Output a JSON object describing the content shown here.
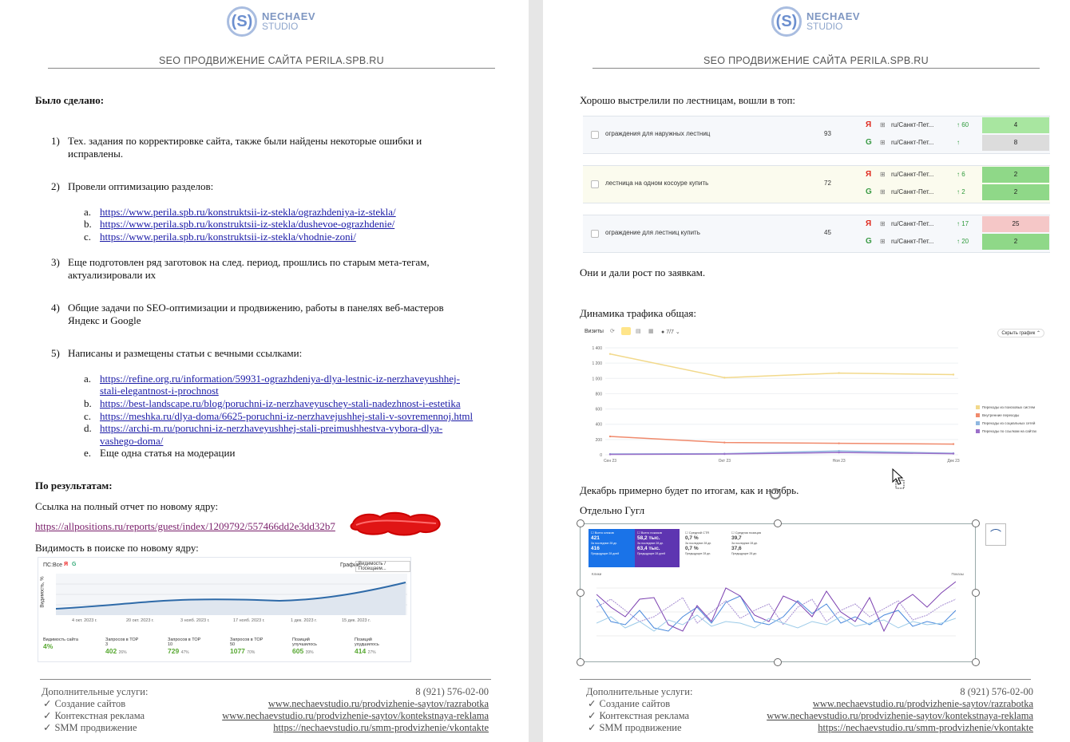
{
  "brand": {
    "name": "NECHAEV",
    "sub": "STUDIO",
    "mark": "(S)"
  },
  "header_title": "SEO ПРОДВИЖЕНИЕ САЙТА PERILA.SPB.RU",
  "left": {
    "done_heading": "Было сделано:",
    "items": [
      {
        "num": "1)",
        "text": "Тех. задания по корректировке сайта, также были найдены некоторые ошибки и исправлены."
      },
      {
        "num": "2)",
        "text": "Провели оптимизацию разделов:",
        "links": [
          {
            "letter": "a.",
            "url": "https://www.perila.spb.ru/konstruktsii-iz-stekla/ograzhdeniya-iz-stekla/"
          },
          {
            "letter": "b.",
            "url": "https://www.perila.spb.ru/konstruktsii-iz-stekla/dushevoe-ograzhdenie/"
          },
          {
            "letter": "c.",
            "url": "https://www.perila.spb.ru/konstruktsii-iz-stekla/vhodnie-zoni/"
          }
        ]
      },
      {
        "num": "3)",
        "text": "Еще подготовлен ряд заготовок на след. период, прошлись по старым мета-тегам, актуализировали их"
      },
      {
        "num": "4)",
        "text": "Общие задачи по SEO-оптимизации и продвижению, работы в панелях веб-мастеров Яндекс и Google"
      },
      {
        "num": "5)",
        "text": "Написаны и размещены статьи с вечными ссылками:",
        "links": [
          {
            "letter": "a.",
            "url_l1": "https://refine.org.ru/information/59931-ograzhdeniya-dlya-lestnic-iz-nerzhaveyushhej-",
            "url_l2": "stali-elegantnost-i-prochnost"
          },
          {
            "letter": "b.",
            "url": "https://best-landscape.ru/blog/poruchni-iz-nerzhaveyuschey-stali-nadezhnost-i-estetika"
          },
          {
            "letter": "c.",
            "url": "https://meshka.ru/dlya-doma/6625-poruchni-iz-nerzhavejushhej-stali-v-sovremennoj.html"
          },
          {
            "letter": "d.",
            "url_l1": "https://archi-m.ru/poruchni-iz-nerzhaveyushhej-stali-preimushhestva-vybora-dlya-",
            "url_l2": "vashego-doma/"
          },
          {
            "letter": "e.",
            "text": "Еще одна статья на модерации"
          }
        ]
      }
    ],
    "results_heading": "По результатам:",
    "report_label": "Ссылка на полный отчет по новому ядру:",
    "report_link": "https://allpositions.ru/reports/guest/index/1209792/557466dd2e3dd32b7",
    "visibility_label": "Видимость в поиске по новому ядру:",
    "vis_chart": {
      "toolbar": {
        "ps": "ПС:",
        "all": "Все",
        "graph": "График:",
        "select": "Видимость / Посещаем..."
      },
      "ylabel": "Видимость, %",
      "xticks": [
        "4 окт. 2023 г.",
        "20 окт. 2023 г.",
        "3 нояб. 2023 г.",
        "17 нояб. 2023 г.",
        "1 дек. 2023 г.",
        "15 дек. 2023 г."
      ],
      "stats": [
        {
          "label": "Видимость сайта",
          "value": "4%",
          "pct": ""
        },
        {
          "label": "Запросов в ТОР 3",
          "value": "402",
          "pct": "26%"
        },
        {
          "label": "Запросов в ТОР 10",
          "value": "729",
          "pct": "47%"
        },
        {
          "label": "Запросов в ТОР 50",
          "value": "1077",
          "pct": "70%"
        },
        {
          "label": "Позиций улучшилось",
          "value": "605",
          "pct": "39%"
        },
        {
          "label": "Позиций ухудшилось",
          "value": "414",
          "pct": "27%"
        }
      ]
    }
  },
  "right": {
    "top_text": "Хорошо выстрелили по лестницам, вошли в топ:",
    "keywords": [
      {
        "kw": "ограждения для наружных лестниц",
        "vol": "93",
        "rows": [
          {
            "engine": "yandex",
            "region": "ru/Санкт-Пет...",
            "chg": "↑ 60",
            "pos": "4"
          },
          {
            "engine": "google",
            "region": "ru/Санкт-Пет...",
            "chg": "↑",
            "pos": "8"
          }
        ]
      },
      {
        "kw": "лестница на одном косоуре купить",
        "vol": "72",
        "rows": [
          {
            "engine": "yandex",
            "region": "ru/Санкт-Пет...",
            "chg": "↑ 6",
            "pos": "2"
          },
          {
            "engine": "google",
            "region": "ru/Санкт-Пет...",
            "chg": "↑ 2",
            "pos": "2"
          }
        ]
      },
      {
        "kw": "ограждение для лестниц купить",
        "vol": "45",
        "rows": [
          {
            "engine": "yandex",
            "region": "ru/Санкт-Пет...",
            "chg": "↑ 17",
            "pos": "25"
          },
          {
            "engine": "google",
            "region": "ru/Санкт-Пет...",
            "chg": "↑ 20",
            "pos": "2"
          }
        ]
      }
    ],
    "growth_text": "Они и дали рост по заявкам.",
    "traffic_label": "Динамика трафика общая:",
    "traffic_toolbar": {
      "visits": "Визиты",
      "period": "7/7",
      "hide": "Скрыть график"
    },
    "december_text": "Декабрь примерно будет по итогам, как и ноябрь.",
    "google_label": "Отдельно Гугл",
    "gsc_cards": [
      {
        "title": "Всего кликов",
        "v1": "421",
        "s1": "За последние 28 дн.",
        "v2": "416",
        "s2": "Предыдущие 28 дней"
      },
      {
        "title": "Всего показов",
        "v1": "58,2 тыс.",
        "s1": "За последние 28 дн.",
        "v2": "63,4 тыс.",
        "s2": "Предыдущие 28 дней"
      },
      {
        "title": "Средний CTR",
        "v1": "0,7 %",
        "s1": "За последние 28 дн.",
        "v2": "0,7 %",
        "s2": "Предыдущие 28 дн."
      },
      {
        "title": "Средняя позиция",
        "v1": "39,7",
        "s1": "За последние 28 дн.",
        "v2": "37,6",
        "s2": "Предыдущие 28 дн."
      }
    ],
    "gsc_axis": {
      "left_title": "Клики",
      "right_title": "Показы"
    }
  },
  "footer": {
    "title": "Дополнительные услуги:",
    "services": [
      "Создание сайтов",
      "Контекстная реклама",
      "SMM продвижение"
    ],
    "phone": "8 (921) 576-02-00",
    "links": [
      "www.nechaevstudio.ru/prodvizhenie-saytov/razrabotka",
      "www.nechaevstudio.ru/prodvizhenie-saytov/kontekstnaya-reklama",
      "https://nechaevstudio.ru/smm-prodvizhenie/vkontakte"
    ]
  },
  "chart_data": [
    {
      "type": "line",
      "title": "",
      "ylabel": "",
      "ylim": [
        0,
        1400
      ],
      "yticks": [
        "1 400",
        "1 200",
        "1 000",
        "800",
        "600",
        "400",
        "200",
        "0"
      ],
      "categories": [
        "Сен 23",
        "Окт 23",
        "Ноя 23",
        "Дек 23"
      ],
      "series": [
        {
          "name": "Переходы из поисковых систем",
          "color": "#f2d98b",
          "values": [
            1320,
            1010,
            1070,
            1050
          ]
        },
        {
          "name": "Внутренние переходы",
          "color": "#f08a6c",
          "values": [
            240,
            160,
            150,
            140
          ]
        },
        {
          "name": "Переходы из социальных сетей",
          "color": "#8fb7e0",
          "values": [
            10,
            15,
            50,
            20
          ]
        },
        {
          "name": "Переходы по ссылкам на сайтах",
          "color": "#9b6fc9",
          "values": [
            5,
            10,
            30,
            15
          ]
        }
      ],
      "legend": "right"
    }
  ]
}
